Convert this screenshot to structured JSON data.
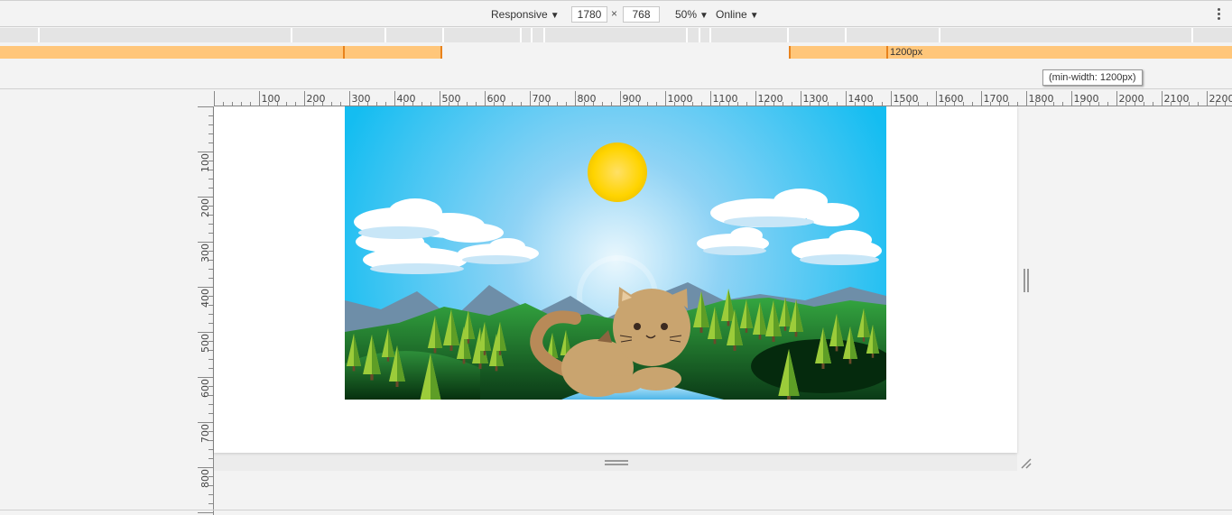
{
  "toolbar": {
    "device": "Responsive",
    "width_value": "1780",
    "height_value": "768",
    "times": "×",
    "zoom": "50%",
    "throttle": "Online",
    "dropdown_arrow": "▼"
  },
  "media_queries": {
    "active_label": "1200px",
    "tooltip": "(min-width: 1200px)"
  },
  "ruler": {
    "horizontal_labels": [
      "100",
      "200",
      "300",
      "400",
      "500",
      "600",
      "700",
      "800",
      "900",
      "1000",
      "1100",
      "1200",
      "1300",
      "1400",
      "1500",
      "1600",
      "1700",
      "1800",
      "1900",
      "2000",
      "2100",
      "2200"
    ],
    "vertical_labels": [
      "100",
      "200",
      "300",
      "400",
      "500",
      "600",
      "700",
      "800"
    ]
  },
  "icons": {
    "more": "vertical-ellipsis-icon",
    "resize_bottom": "resize-handle-icon",
    "resize_right": "resize-handle-icon",
    "resize_corner": "corner-resize-icon"
  },
  "colors": {
    "media_query_orange": "#ffc67a",
    "media_query_tick": "#e8821c",
    "sky_top": "#1bbcf0",
    "sun": "#ffd400",
    "cat": "#c9a46f"
  }
}
